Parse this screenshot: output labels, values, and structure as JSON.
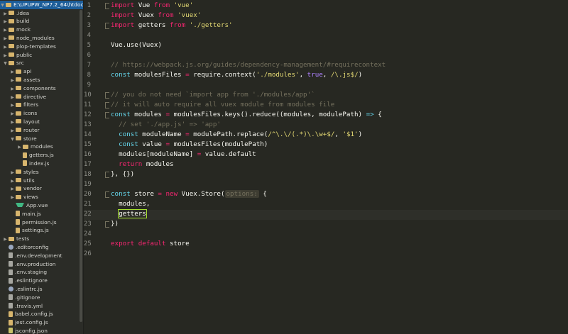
{
  "sidebar": {
    "root": "E:\\UPUPW_NP7.2_64\\htdocs\\...",
    "items": [
      {
        "label": ".idea",
        "type": "folder",
        "depth": 1,
        "state": "closed"
      },
      {
        "label": "build",
        "type": "folder",
        "depth": 1,
        "state": "closed"
      },
      {
        "label": "mock",
        "type": "folder",
        "depth": 1,
        "state": "closed"
      },
      {
        "label": "node_modules",
        "type": "folder",
        "depth": 1,
        "state": "closed"
      },
      {
        "label": "plop-templates",
        "type": "folder",
        "depth": 1,
        "state": "closed"
      },
      {
        "label": "public",
        "type": "folder",
        "depth": 1,
        "state": "closed"
      },
      {
        "label": "src",
        "type": "folder",
        "depth": 1,
        "state": "open"
      },
      {
        "label": "api",
        "type": "folder",
        "depth": 2,
        "state": "closed"
      },
      {
        "label": "assets",
        "type": "folder",
        "depth": 2,
        "state": "closed"
      },
      {
        "label": "components",
        "type": "folder",
        "depth": 2,
        "state": "closed"
      },
      {
        "label": "directive",
        "type": "folder",
        "depth": 2,
        "state": "closed"
      },
      {
        "label": "filters",
        "type": "folder",
        "depth": 2,
        "state": "closed"
      },
      {
        "label": "icons",
        "type": "folder",
        "depth": 2,
        "state": "closed"
      },
      {
        "label": "layout",
        "type": "folder",
        "depth": 2,
        "state": "closed"
      },
      {
        "label": "router",
        "type": "folder",
        "depth": 2,
        "state": "closed"
      },
      {
        "label": "store",
        "type": "folder",
        "depth": 2,
        "state": "open"
      },
      {
        "label": "modules",
        "type": "folder",
        "depth": 3,
        "state": "closed"
      },
      {
        "label": "getters.js",
        "type": "js",
        "depth": 3
      },
      {
        "label": "index.js",
        "type": "js",
        "depth": 3
      },
      {
        "label": "styles",
        "type": "folder",
        "depth": 2,
        "state": "closed"
      },
      {
        "label": "utils",
        "type": "folder",
        "depth": 2,
        "state": "closed"
      },
      {
        "label": "vendor",
        "type": "folder",
        "depth": 2,
        "state": "closed"
      },
      {
        "label": "views",
        "type": "folder",
        "depth": 2,
        "state": "closed"
      },
      {
        "label": "App.vue",
        "type": "vue",
        "depth": 2
      },
      {
        "label": "main.js",
        "type": "js",
        "depth": 2
      },
      {
        "label": "permission.js",
        "type": "js",
        "depth": 2
      },
      {
        "label": "settings.js",
        "type": "js",
        "depth": 2
      },
      {
        "label": "tests",
        "type": "folder",
        "depth": 1,
        "state": "closed"
      },
      {
        "label": ".editorconfig",
        "type": "gear",
        "depth": 1
      },
      {
        "label": ".env.development",
        "type": "file",
        "depth": 1
      },
      {
        "label": ".env.production",
        "type": "file",
        "depth": 1
      },
      {
        "label": ".env.staging",
        "type": "file",
        "depth": 1
      },
      {
        "label": ".eslintignore",
        "type": "file",
        "depth": 1
      },
      {
        "label": ".eslintrc.js",
        "type": "gear",
        "depth": 1
      },
      {
        "label": ".gitignore",
        "type": "file",
        "depth": 1
      },
      {
        "label": ".travis.yml",
        "type": "file",
        "depth": 1
      },
      {
        "label": "babel.config.js",
        "type": "js",
        "depth": 1
      },
      {
        "label": "jest.config.js",
        "type": "js",
        "depth": 1
      },
      {
        "label": "jsconfig.json",
        "type": "json",
        "depth": 1
      }
    ]
  },
  "editor": {
    "cursor_line": 22,
    "lines": [
      {
        "n": "1",
        "fold": true,
        "tokens": [
          [
            "kw2",
            "import"
          ],
          [
            "plain",
            " Vue "
          ],
          [
            "kw2",
            "from"
          ],
          [
            "plain",
            " "
          ],
          [
            "str",
            "'vue'"
          ]
        ]
      },
      {
        "n": "2",
        "tokens": [
          [
            "kw2",
            "import"
          ],
          [
            "plain",
            " Vuex "
          ],
          [
            "kw2",
            "from"
          ],
          [
            "plain",
            " "
          ],
          [
            "str",
            "'vuex'"
          ]
        ]
      },
      {
        "n": "3",
        "fold": true,
        "tokens": [
          [
            "kw2",
            "import"
          ],
          [
            "plain",
            " getters "
          ],
          [
            "kw2",
            "from"
          ],
          [
            "plain",
            " "
          ],
          [
            "str",
            "'./getters'"
          ]
        ]
      },
      {
        "n": "4",
        "tokens": []
      },
      {
        "n": "5",
        "tokens": [
          [
            "plain",
            "Vue.use(Vuex)"
          ]
        ]
      },
      {
        "n": "6",
        "tokens": []
      },
      {
        "n": "7",
        "tokens": [
          [
            "cmt",
            "// https://webpack.js.org/guides/dependency-management/#requirecontext"
          ]
        ]
      },
      {
        "n": "8",
        "tokens": [
          [
            "kw",
            "const"
          ],
          [
            "plain",
            " modulesFiles "
          ],
          [
            "kw2",
            "="
          ],
          [
            "plain",
            " require.context("
          ],
          [
            "str",
            "'./modules'"
          ],
          [
            "plain",
            ", "
          ],
          [
            "num",
            "true"
          ],
          [
            "plain",
            ", "
          ],
          [
            "str",
            "/\\.js$/"
          ],
          [
            "plain",
            ")"
          ]
        ]
      },
      {
        "n": "9",
        "tokens": []
      },
      {
        "n": "10",
        "fold": true,
        "tokens": [
          [
            "cmt",
            "// you do not need `import app from './modules/app'`"
          ]
        ]
      },
      {
        "n": "11",
        "fold": true,
        "tokens": [
          [
            "cmt",
            "// it will auto require all vuex module from modules file"
          ]
        ]
      },
      {
        "n": "12",
        "fold": true,
        "tokens": [
          [
            "kw",
            "const"
          ],
          [
            "plain",
            " modules "
          ],
          [
            "kw2",
            "="
          ],
          [
            "plain",
            " modulesFiles.keys().reduce((modules, modulePath) "
          ],
          [
            "kw",
            "=>"
          ],
          [
            "plain",
            " {"
          ]
        ]
      },
      {
        "n": "13",
        "tokens": [
          [
            "cmt",
            "  // set './app.js' => 'app'"
          ]
        ]
      },
      {
        "n": "14",
        "tokens": [
          [
            "plain",
            "  "
          ],
          [
            "kw",
            "const"
          ],
          [
            "plain",
            " moduleName "
          ],
          [
            "kw2",
            "="
          ],
          [
            "plain",
            " modulePath.replace("
          ],
          [
            "str",
            "/^\\.\\/(.*)\\.\\w+$/"
          ],
          [
            "plain",
            ", "
          ],
          [
            "str",
            "'$1'"
          ],
          [
            "plain",
            ")"
          ]
        ]
      },
      {
        "n": "15",
        "tokens": [
          [
            "plain",
            "  "
          ],
          [
            "kw",
            "const"
          ],
          [
            "plain",
            " value "
          ],
          [
            "kw2",
            "="
          ],
          [
            "plain",
            " modulesFiles(modulePath)"
          ]
        ]
      },
      {
        "n": "16",
        "tokens": [
          [
            "plain",
            "  modules[moduleName] "
          ],
          [
            "kw2",
            "="
          ],
          [
            "plain",
            " value.default"
          ]
        ]
      },
      {
        "n": "17",
        "tokens": [
          [
            "plain",
            "  "
          ],
          [
            "kw2",
            "return"
          ],
          [
            "plain",
            " modules"
          ]
        ]
      },
      {
        "n": "18",
        "fold": true,
        "tokens": [
          [
            "plain",
            "}, {})"
          ]
        ]
      },
      {
        "n": "19",
        "tokens": []
      },
      {
        "n": "20",
        "fold": true,
        "tokens": [
          [
            "kw",
            "const"
          ],
          [
            "plain",
            " store "
          ],
          [
            "kw2",
            "="
          ],
          [
            "plain",
            " "
          ],
          [
            "kw2",
            "new"
          ],
          [
            "plain",
            " Vuex.Store("
          ],
          [
            "hint",
            "options:"
          ],
          [
            "plain",
            " {"
          ]
        ]
      },
      {
        "n": "21",
        "tokens": [
          [
            "plain",
            "  modules,"
          ]
        ]
      },
      {
        "n": "22",
        "tokens": [
          [
            "plain",
            "  "
          ],
          [
            "hlbox",
            "getters"
          ]
        ]
      },
      {
        "n": "23",
        "fold": true,
        "tokens": [
          [
            "plain",
            "})"
          ]
        ]
      },
      {
        "n": "24",
        "tokens": []
      },
      {
        "n": "25",
        "tokens": [
          [
            "kw2",
            "export"
          ],
          [
            "plain",
            " "
          ],
          [
            "kw2",
            "default"
          ],
          [
            "plain",
            " store"
          ]
        ]
      },
      {
        "n": "26",
        "tokens": []
      }
    ]
  },
  "colors": {
    "background": "#272822",
    "sidebar_bg": "#2b2c27",
    "selection": "#1c5d99",
    "keyword": "#66d9ef",
    "operator": "#f92672",
    "string": "#e6db74",
    "comment": "#75715e"
  }
}
